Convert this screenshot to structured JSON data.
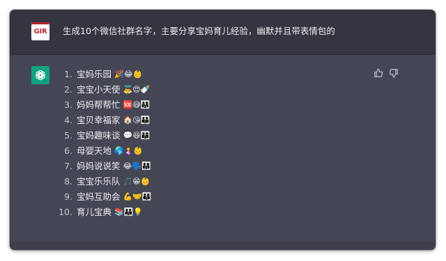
{
  "conversation": {
    "user": {
      "avatar_text": "GIR",
      "prompt": "生成10个微信社群名字，主要分享宝妈育儿经验，幽默并且带表情包的"
    },
    "assistant": {
      "avatar_icon": "openai-logo-icon",
      "items": [
        {
          "num": "1.",
          "text": "宝妈乐园",
          "emoji": "🎉😂👶"
        },
        {
          "num": "2.",
          "text": "宝宝小天使",
          "emoji": "👼😍🍼"
        },
        {
          "num": "3.",
          "text": "妈妈帮帮忙",
          "emoji": "🆘😅👨‍👩‍👧"
        },
        {
          "num": "4.",
          "text": "宝贝幸福家",
          "emoji": "🏠😘👪"
        },
        {
          "num": "5.",
          "text": "宝妈趣味谈",
          "emoji": "💬😆👨‍👩‍👦"
        },
        {
          "num": "6.",
          "text": "母婴天地",
          "emoji": "🌎🤱👶"
        },
        {
          "num": "7.",
          "text": "妈妈说说笑",
          "emoji": "😂🗣️👨‍👩‍👧"
        },
        {
          "num": "8.",
          "text": "宝宝乐乐队",
          "emoji": "🎵😁👶"
        },
        {
          "num": "9.",
          "text": "宝妈互助会",
          "emoji": "💪🤝👨‍👩‍👦"
        },
        {
          "num": "10.",
          "text": "育儿宝典",
          "emoji": "📚👪💡"
        }
      ],
      "actions": [
        {
          "name": "thumbs-up-icon"
        },
        {
          "name": "thumbs-down-icon"
        }
      ]
    }
  },
  "colors": {
    "user_bg": "#343541",
    "assistant_bg": "#444654",
    "bot_avatar": "#10a37f",
    "text": "#ececf1"
  }
}
